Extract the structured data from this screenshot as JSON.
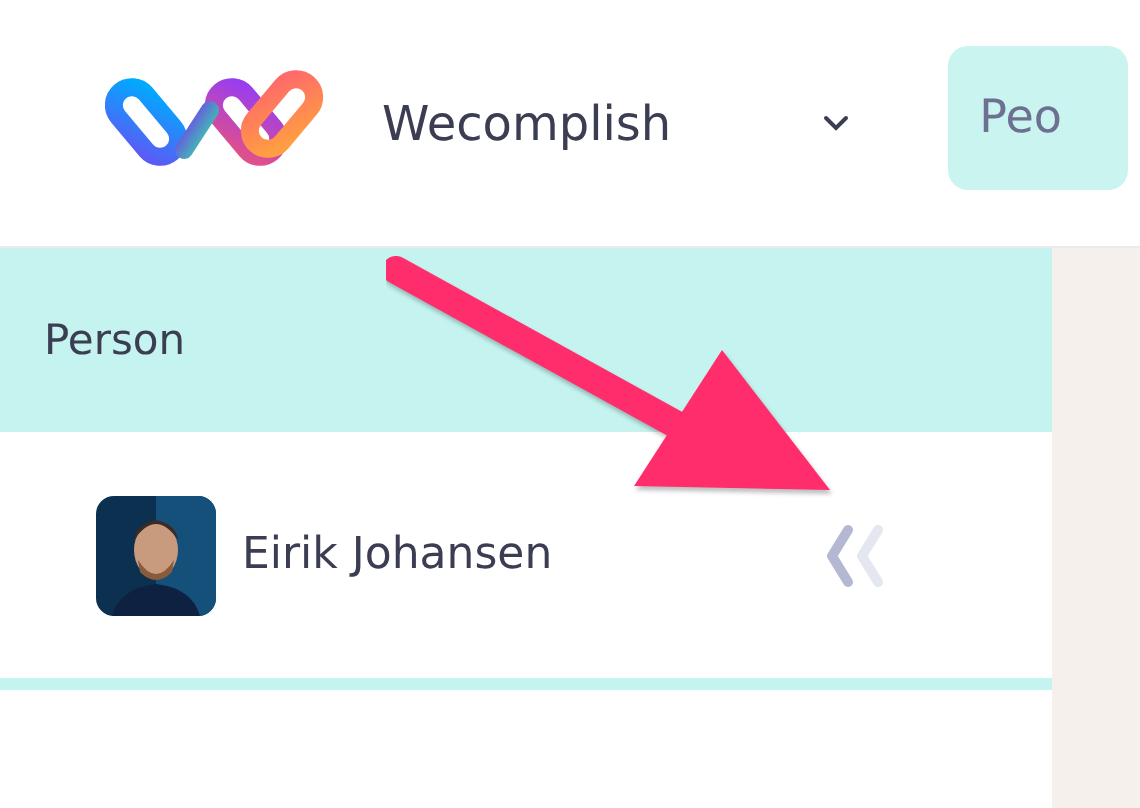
{
  "header": {
    "workspace": "Wecomplish",
    "tab": {
      "label": "Peo",
      "selected": true
    }
  },
  "table": {
    "column": "Person",
    "rows": [
      {
        "name": "Eirik Johansen"
      }
    ]
  }
}
